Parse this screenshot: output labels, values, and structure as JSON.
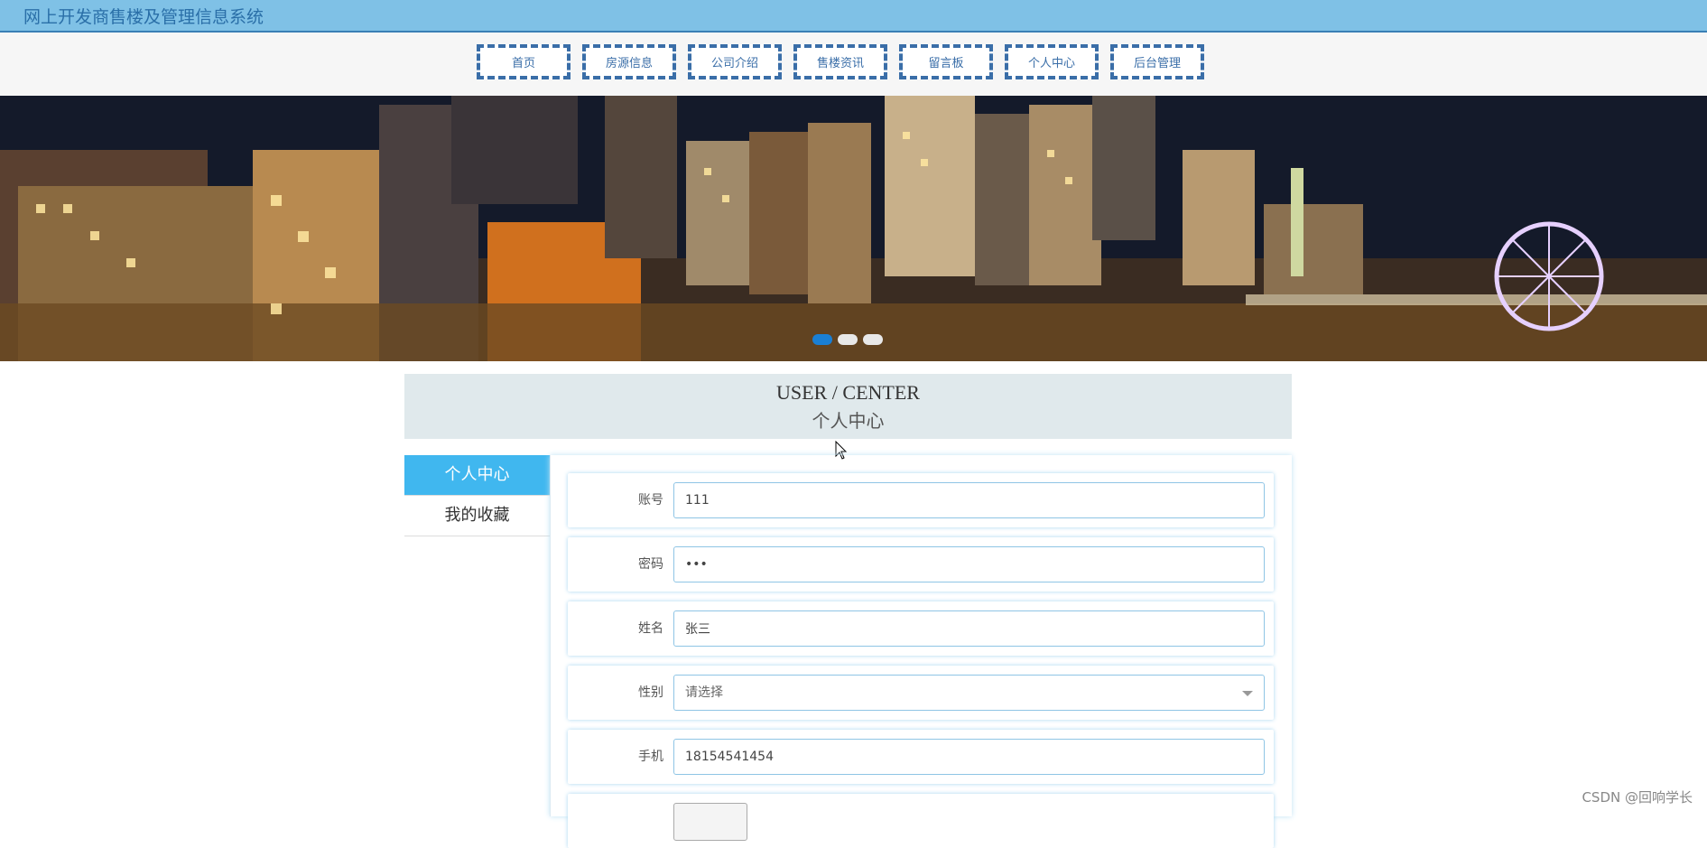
{
  "header": {
    "site_title": "网上开发商售楼及管理信息系统"
  },
  "nav": {
    "items": [
      {
        "label": "首页"
      },
      {
        "label": "房源信息"
      },
      {
        "label": "公司介绍"
      },
      {
        "label": "售楼资讯"
      },
      {
        "label": "留言板"
      },
      {
        "label": "个人中心"
      },
      {
        "label": "后台管理"
      }
    ]
  },
  "banner": {
    "slide_count": 3,
    "active_slide": 1
  },
  "user_center": {
    "title_en": "USER / CENTER",
    "title_cn": "个人中心"
  },
  "sidebar": {
    "items": [
      {
        "label": "个人中心",
        "active": true
      },
      {
        "label": "我的收藏",
        "active": false
      }
    ]
  },
  "form": {
    "account": {
      "label": "账号",
      "value": "111"
    },
    "password": {
      "label": "密码",
      "value": "•••"
    },
    "name": {
      "label": "姓名",
      "value": "张三"
    },
    "gender": {
      "label": "性别",
      "placeholder": "请选择"
    },
    "phone": {
      "label": "手机",
      "value": "18154541454"
    }
  },
  "watermark": "CSDN @回响学长",
  "colors": {
    "accent": "#40b7ef",
    "nav_border": "#3a6ea8",
    "topbar": "#7fc1e6"
  }
}
